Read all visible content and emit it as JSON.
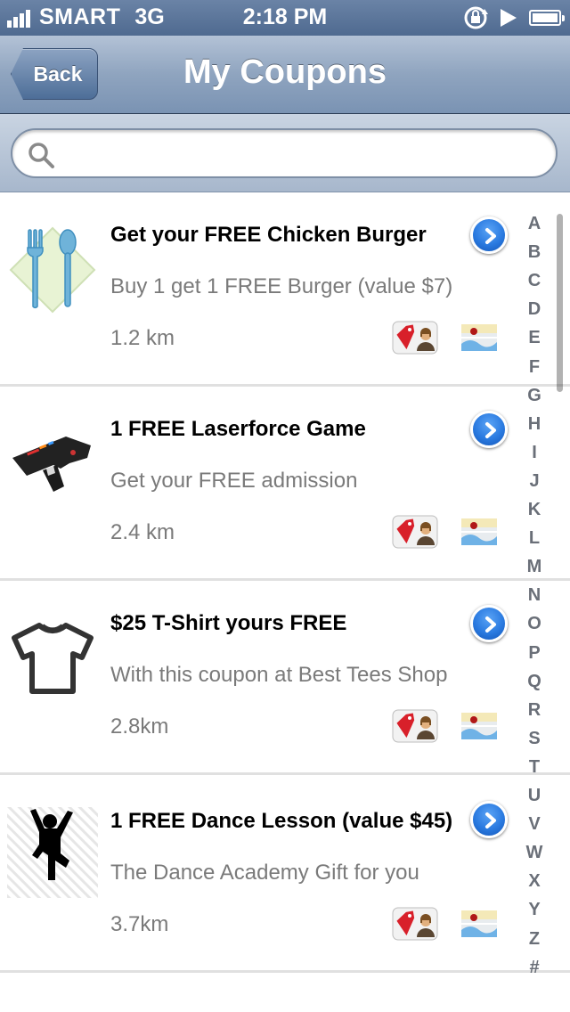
{
  "status_bar": {
    "carrier": "SMART",
    "network": "3G",
    "time": "2:18 PM",
    "icons": [
      "signal-icon",
      "rotation-lock-icon",
      "play-icon",
      "battery-icon"
    ]
  },
  "nav": {
    "back_label": "Back",
    "title": "My Coupons"
  },
  "search": {
    "placeholder": "",
    "value": ""
  },
  "coupons": [
    {
      "title": "Get your FREE Chicken Burger",
      "description": "Buy 1 get 1 FREE Burger (value $7)",
      "distance": "1.2 km",
      "image": "fork-spoon-icon"
    },
    {
      "title": "1 FREE Laserforce Game",
      "description": "Get your FREE admission",
      "distance": "2.4 km",
      "image": "laser-gun-icon"
    },
    {
      "title": "$25 T-Shirt yours FREE",
      "description": "With this coupon at Best Tees Shop",
      "distance": "2.8km",
      "image": "tshirt-icon"
    },
    {
      "title": "1 FREE Dance Lesson (value $45)",
      "description": "The Dance Academy Gift for you",
      "distance": "3.7km",
      "image": "dancer-icon"
    }
  ],
  "index_letters": [
    "A",
    "B",
    "C",
    "D",
    "E",
    "F",
    "G",
    "H",
    "I",
    "J",
    "K",
    "L",
    "M",
    "N",
    "O",
    "P",
    "Q",
    "R",
    "S",
    "T",
    "U",
    "V",
    "W",
    "X",
    "Y",
    "Z",
    "#"
  ],
  "colors": {
    "nav_bar": "#8fa4bf",
    "detail_button": "#2a7ae0",
    "secondary_text": "#7a7a7a"
  }
}
